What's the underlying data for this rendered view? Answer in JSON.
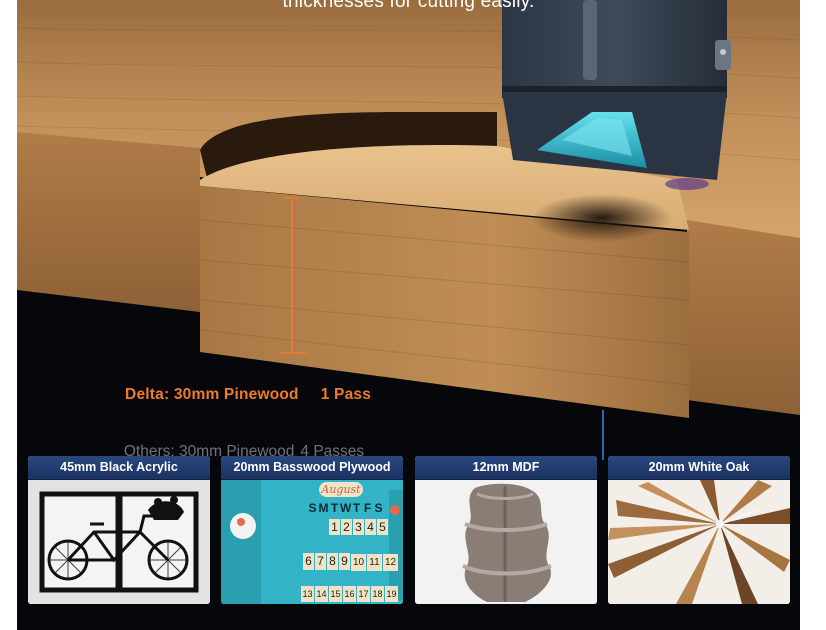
{
  "caption": {
    "top_text": "thicknesses for cutting easily."
  },
  "comparison": {
    "delta_label": "Delta: 30mm Pinewood",
    "delta_passes": "1 Pass",
    "others_label": "Others: 30mm Pinewood",
    "others_passes": "4 Passes"
  },
  "calendar": {
    "month": "August",
    "weekdays": [
      "S",
      "M",
      "T",
      "W",
      "T",
      "F",
      "S"
    ],
    "row1": [
      "1",
      "2",
      "3",
      "4",
      "5"
    ],
    "row2": [
      "6",
      "7",
      "8",
      "9",
      "10",
      "11",
      "12"
    ],
    "row3": [
      "13",
      "14",
      "15",
      "16",
      "17",
      "18",
      "19"
    ]
  },
  "materials": [
    {
      "title": "45mm Black Acrylic",
      "image": "bicycle-panel-icon"
    },
    {
      "title": "20mm Basswood Plywood",
      "image": "calendar-board-icon"
    },
    {
      "title": "12mm MDF",
      "image": "corner-shelf-icon"
    },
    {
      "title": "20mm White Oak",
      "image": "wooden-clock-icon"
    }
  ],
  "colors": {
    "accent_orange": "#f07a2e",
    "header_blue": "#1f3a70",
    "background": "#05070b",
    "wood": "#c8955a",
    "laser_cyan": "#3ec4d6"
  }
}
